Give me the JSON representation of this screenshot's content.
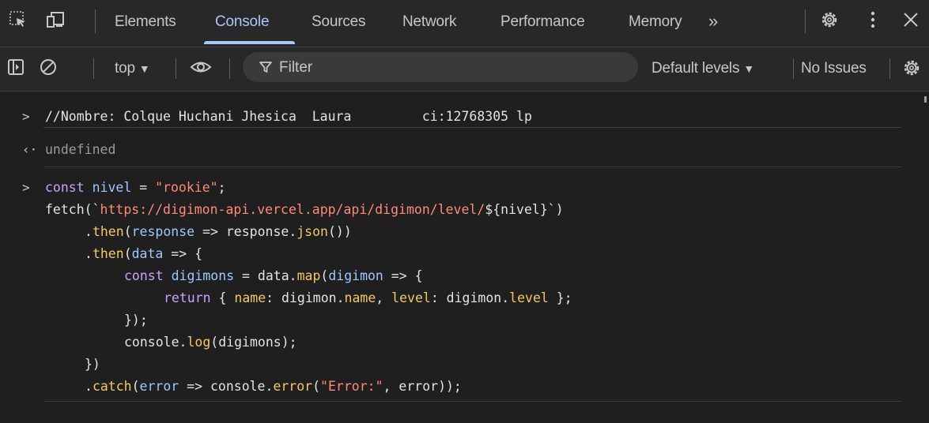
{
  "tabs": {
    "elements": "Elements",
    "console": "Console",
    "sources": "Sources",
    "network": "Network",
    "performance": "Performance",
    "memory": "Memory",
    "more": "»"
  },
  "toolbar": {
    "context": "top",
    "filter_placeholder": "Filter",
    "levels": "Default levels",
    "issues": "No Issues"
  },
  "console": {
    "entry1": "//Nombre: Colque Huchani Jhesica  Laura         ci:12768305 lp",
    "result1": "undefined",
    "code": {
      "l1_kw": "const",
      "l1_var": "nivel",
      "l1_eq": " = ",
      "l1_str": "\"rookie\"",
      "l1_end": ";",
      "l2_a": "fetch(`",
      "l2_url": "https://digimon-api.vercel.app/api/digimon/level/",
      "l2_tpl": "${nivel}",
      "l2_end": "`)",
      "l3_dot": ".",
      "l3_then": "then",
      "l3_rest_open": "(",
      "l3_param": "response",
      "l3_arrow": " => response.",
      "l3_json": "json",
      "l3_close": "())",
      "l4_dot": ".",
      "l4_then": "then",
      "l4_open": "(",
      "l4_param": "data",
      "l4_arrow": " => {",
      "l5_kw": "const",
      "l5_var": "digimons",
      "l5_eq": " = data.",
      "l5_map": "map",
      "l5_open": "(",
      "l5_param": "digimon",
      "l5_arrow": " => {",
      "l6_kw": "return",
      "l6_a": " { ",
      "l6_name": "name",
      "l6_b": ": digimon.",
      "l6_name2": "name",
      "l6_c": ", ",
      "l6_level": "level",
      "l6_d": ": digimon.",
      "l6_level2": "level",
      "l6_e": " };",
      "l7": "});",
      "l8_a": "console.",
      "l8_log": "log",
      "l8_b": "(digimons);",
      "l9": "})",
      "l10_dot": ".",
      "l10_catch": "catch",
      "l10_open": "(",
      "l10_param": "error",
      "l10_arrow": " => console.",
      "l10_error": "error",
      "l10_paren": "(",
      "l10_str": "\"Error:\"",
      "l10_end": ", error));"
    }
  },
  "colors": {
    "accent": "#a8c7fa",
    "keyword": "#c7a3ff",
    "string": "#ff8a76",
    "function": "#f4c95d",
    "variable": "#9cc8ff"
  }
}
